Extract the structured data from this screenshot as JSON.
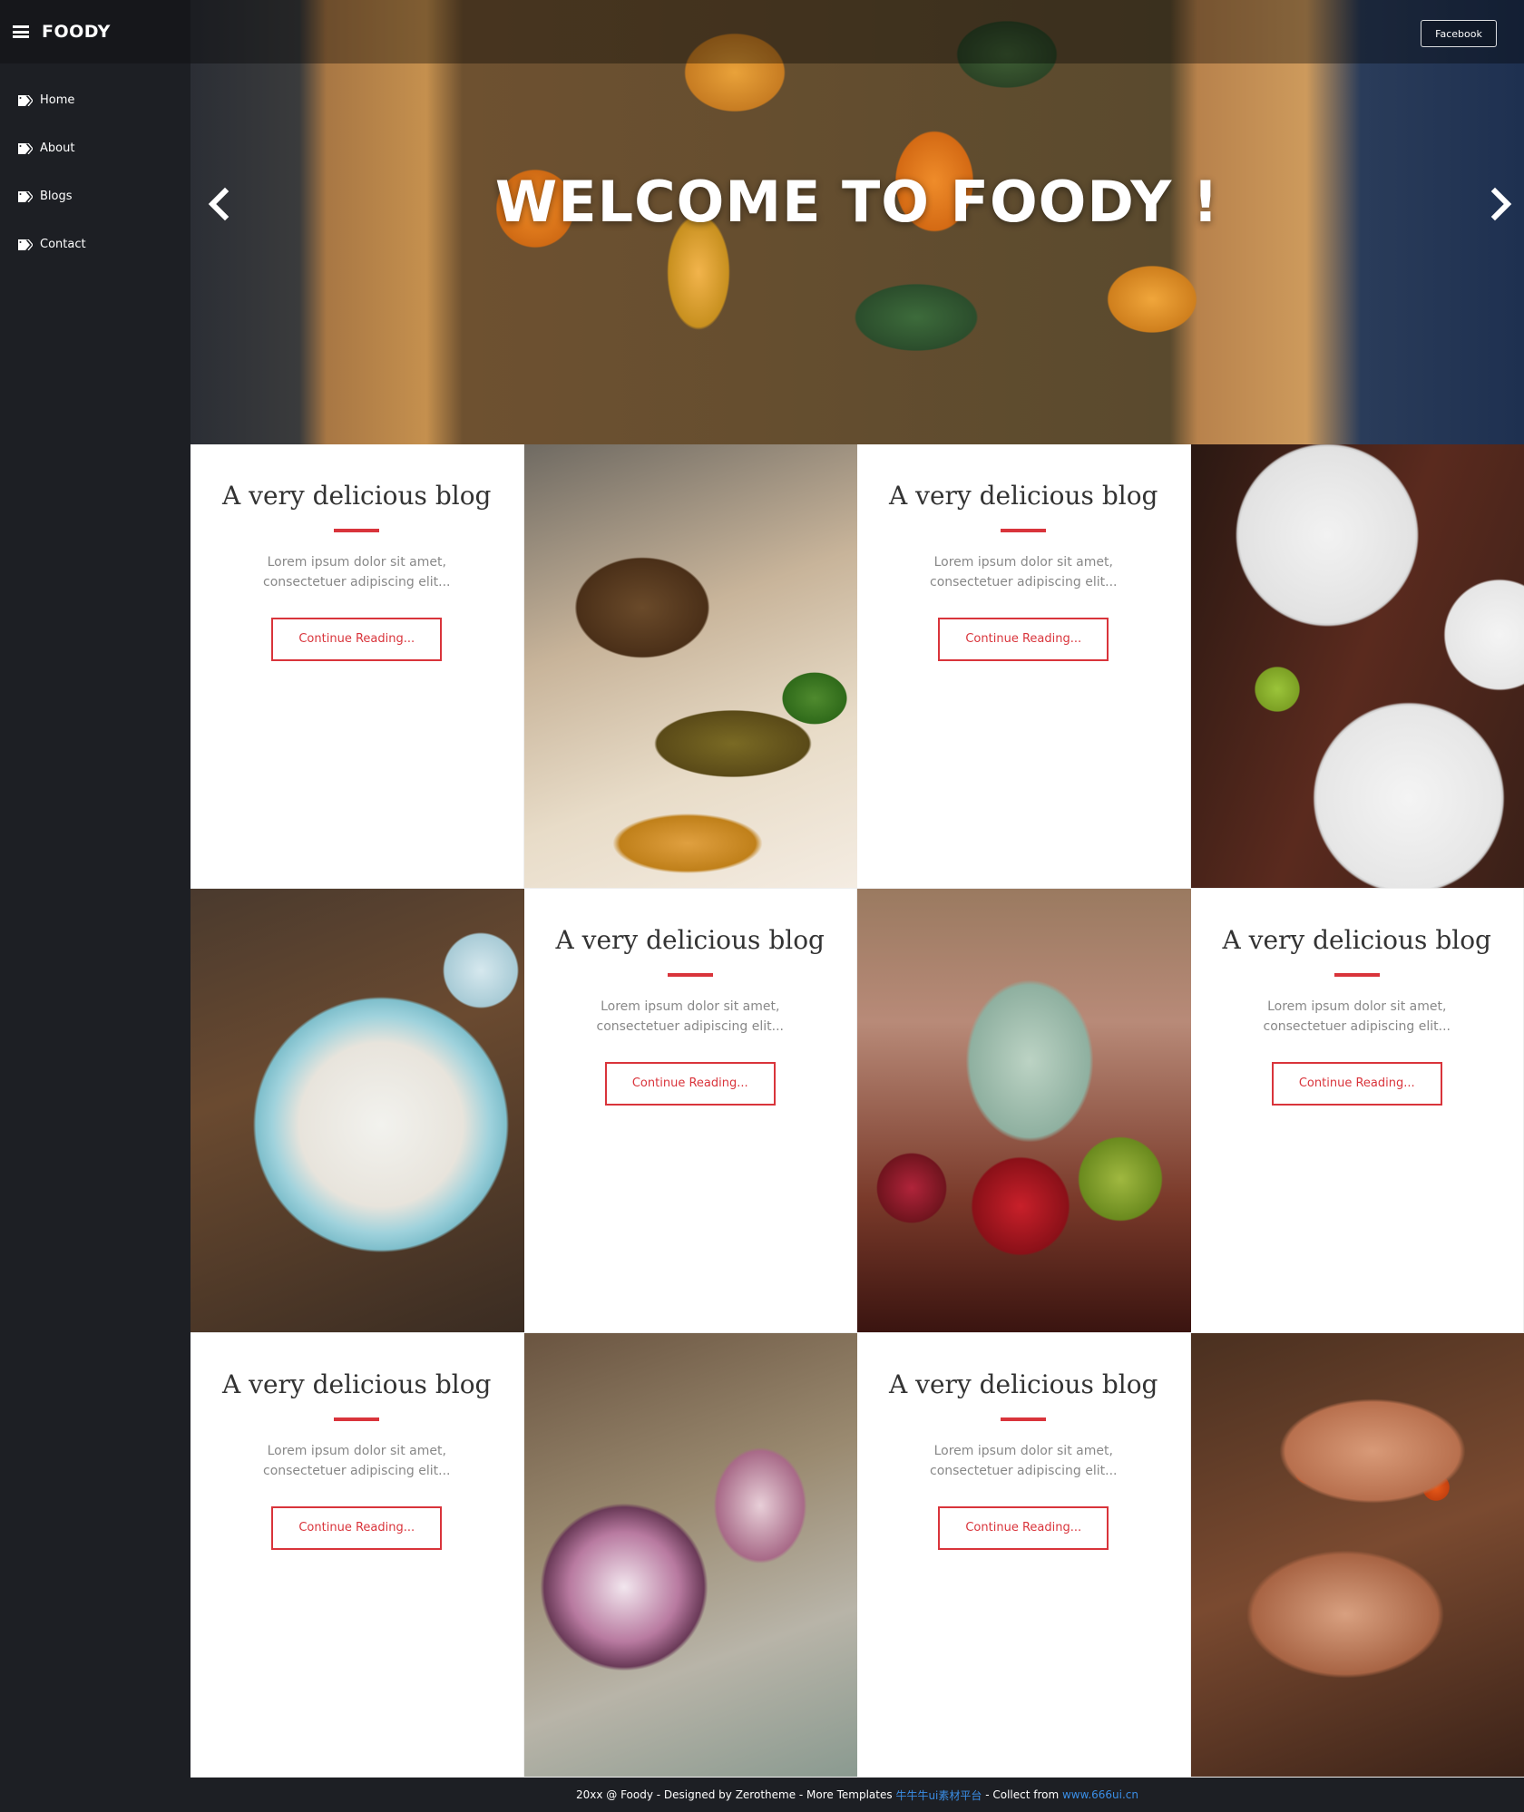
{
  "brand": {
    "name": "FOODY"
  },
  "nav": [
    {
      "label": "Home"
    },
    {
      "label": "About"
    },
    {
      "label": "Blogs"
    },
    {
      "label": "Contact"
    }
  ],
  "hero": {
    "title": "WELCOME TO FOODY !",
    "facebook_label": "Facebook"
  },
  "cards": [
    {
      "title": "A very delicious blog",
      "excerpt": "Lorem ipsum dolor sit amet, consectetuer adipiscing elit...",
      "button": "Continue Reading..."
    },
    {
      "title": "A very delicious blog",
      "excerpt": "Lorem ipsum dolor sit amet, consectetuer adipiscing elit...",
      "button": "Continue Reading..."
    },
    {
      "title": "A very delicious blog",
      "excerpt": "Lorem ipsum dolor sit amet, consectetuer adipiscing elit...",
      "button": "Continue Reading..."
    },
    {
      "title": "A very delicious blog",
      "excerpt": "Lorem ipsum dolor sit amet, consectetuer adipiscing elit...",
      "button": "Continue Reading..."
    },
    {
      "title": "A very delicious blog",
      "excerpt": "Lorem ipsum dolor sit amet, consectetuer adipiscing elit...",
      "button": "Continue Reading..."
    },
    {
      "title": "A very delicious blog",
      "excerpt": "Lorem ipsum dolor sit amet, consectetuer adipiscing elit...",
      "button": "Continue Reading..."
    }
  ],
  "footer": {
    "prefix": "20xx @ Foody - Designed by Zerotheme - More Templates ",
    "templates_link": "牛牛牛ui素材平台",
    "middle": " - Collect from ",
    "collect_link": "www.666ui.cn"
  },
  "colors": {
    "accent": "#d9343b",
    "sidebar": "#1d1f24",
    "link": "#3a8ee6"
  },
  "icons": {
    "menu": "hamburger-icon",
    "nav_item": "tag-icon",
    "prev": "chevron-left-icon",
    "next": "chevron-right-icon"
  }
}
